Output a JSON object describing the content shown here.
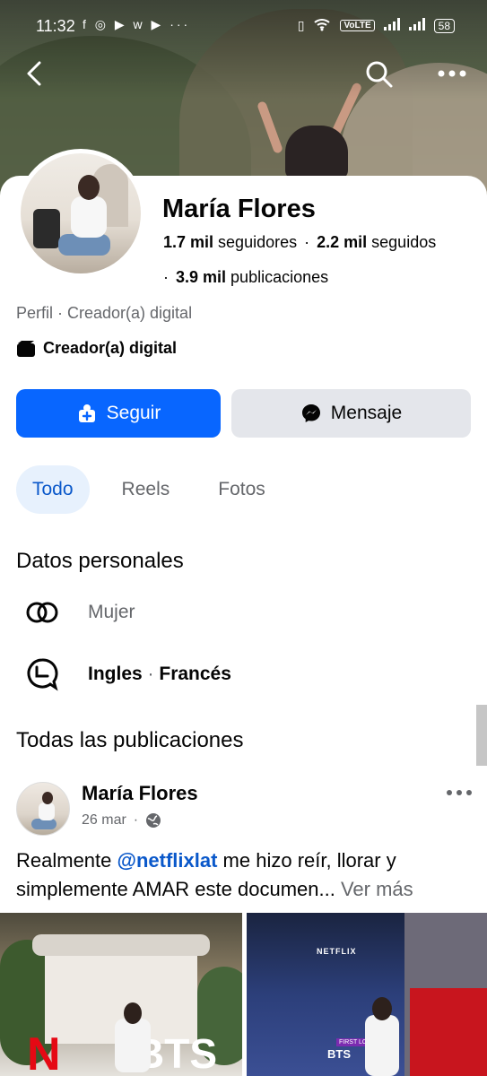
{
  "status_bar": {
    "time": "11:32",
    "app_icons": "f ◎ ▶ w ▶ ···",
    "network_badge": "VoLTE",
    "battery": "58"
  },
  "profile": {
    "name": "María Flores",
    "followers_count": "1.7 mil",
    "followers_label": "seguidores",
    "following_count": "2.2 mil",
    "following_label": "seguidos",
    "posts_count": "3.9 mil",
    "posts_label": "publicaciones",
    "profile_type": "Perfil · Creador(a) digital",
    "category": "Creador(a) digital"
  },
  "actions": {
    "follow_label": "Seguir",
    "message_label": "Mensaje"
  },
  "tabs": [
    {
      "label": "Todo",
      "active": true
    },
    {
      "label": "Reels",
      "active": false
    },
    {
      "label": "Fotos",
      "active": false
    }
  ],
  "personal": {
    "title": "Datos personales",
    "gender": "Mujer",
    "language_1": "Ingles",
    "language_sep": "·",
    "language_2": "Francés"
  },
  "posts_section": {
    "title": "Todas las publicaciones"
  },
  "post": {
    "author": "María Flores",
    "date": "26 mar",
    "date_sep": "·",
    "text_before": "Realmente ",
    "mention": "@netflixlat",
    "text_after": " me hizo reír, llorar y simplemente AMAR este documen...",
    "see_more": "Ver más",
    "photo1_sign": "N",
    "photo1_word": "BTS",
    "photo2_logo": "NETFLIX",
    "photo2_tag": "FIRST LOOK",
    "photo2_title": "BTS"
  },
  "colors": {
    "accent": "#0866ff",
    "tab_active_bg": "#e7f1fd",
    "secondary_text": "#65676b"
  }
}
